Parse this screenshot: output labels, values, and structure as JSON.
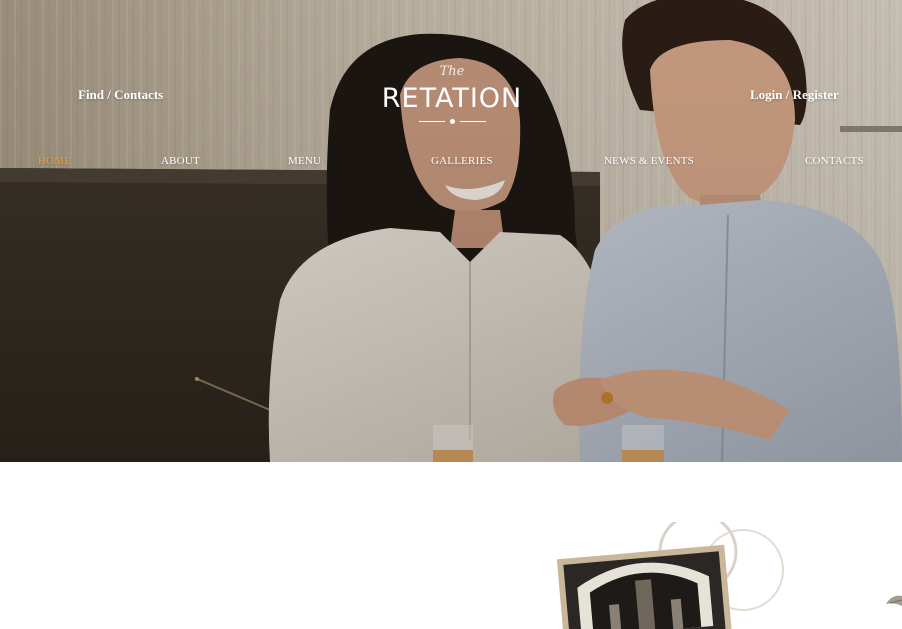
{
  "header": {
    "find_contacts": "Find / Contacts",
    "login_register": "Login / Register",
    "logo": {
      "small": "The",
      "name": "RETATION"
    }
  },
  "nav": {
    "items": [
      {
        "label": "HOME",
        "active": true
      },
      {
        "label": "ABOUT",
        "active": false
      },
      {
        "label": "MENU",
        "active": false
      },
      {
        "label": "GALLERIES",
        "active": false
      },
      {
        "label": "NEWS & EVENTS",
        "active": false
      },
      {
        "label": "CONTACTS",
        "active": false
      }
    ]
  },
  "colors": {
    "nav_active": "#e8a33a",
    "nav_text": "#ffffff",
    "hero_tone": "#b7aa97",
    "page_bg": "#ffffff"
  }
}
